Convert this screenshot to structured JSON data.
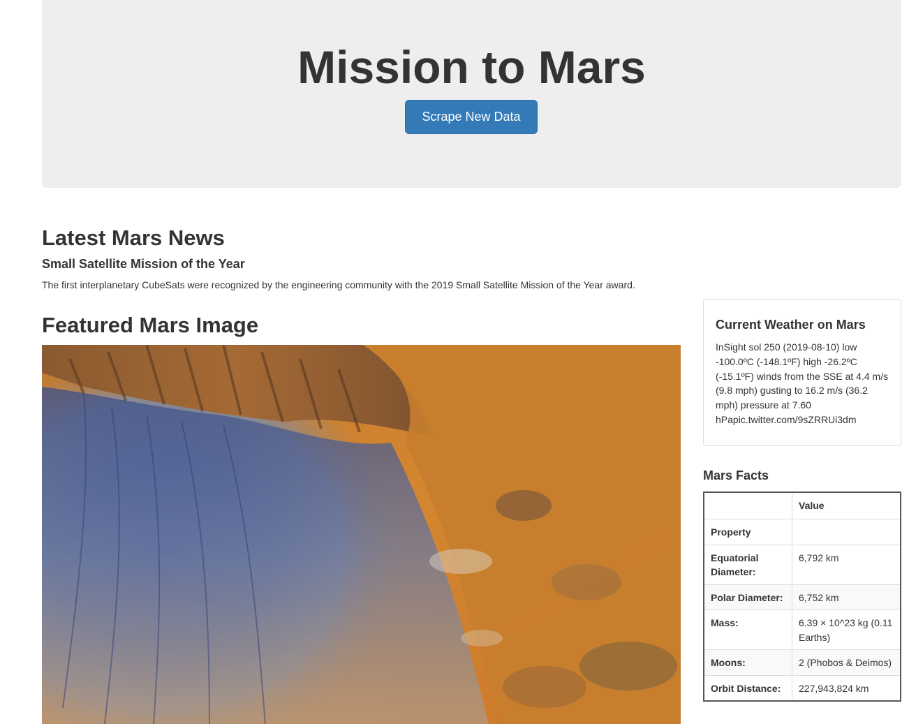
{
  "header": {
    "title": "Mission to Mars",
    "scrape_button": "Scrape New Data"
  },
  "news": {
    "heading": "Latest Mars News",
    "title": "Small Satellite Mission of the Year",
    "paragraph": "The first interplanetary CubeSats were recognized by the engineering community with the 2019 Small Satellite Mission of the Year award."
  },
  "featured": {
    "heading": "Featured Mars Image",
    "image_alt": "Mars crater slope image"
  },
  "weather": {
    "title": "Current Weather on Mars",
    "text": "InSight sol 250 (2019-08-10) low -100.0ºC (-148.1ºF) high -26.2ºC (-15.1ºF) winds from the SSE at 4.4 m/s (9.8 mph) gusting to 16.2 m/s (36.2 mph) pressure at 7.60 hPapic.twitter.com/9sZRRUi3dm"
  },
  "facts": {
    "title": "Mars Facts",
    "header_col1": "",
    "header_col2": "Value",
    "rows": [
      {
        "property": "Property",
        "value": ""
      },
      {
        "property": "Equatorial Diameter:",
        "value": "6,792 km"
      },
      {
        "property": "Polar Diameter:",
        "value": "6,752 km"
      },
      {
        "property": "Mass:",
        "value": "6.39 × 10^23 kg (0.11 Earths)"
      },
      {
        "property": "Moons:",
        "value": "2 (Phobos & Deimos)"
      },
      {
        "property": "Orbit Distance:",
        "value": "227,943,824 km"
      }
    ]
  }
}
